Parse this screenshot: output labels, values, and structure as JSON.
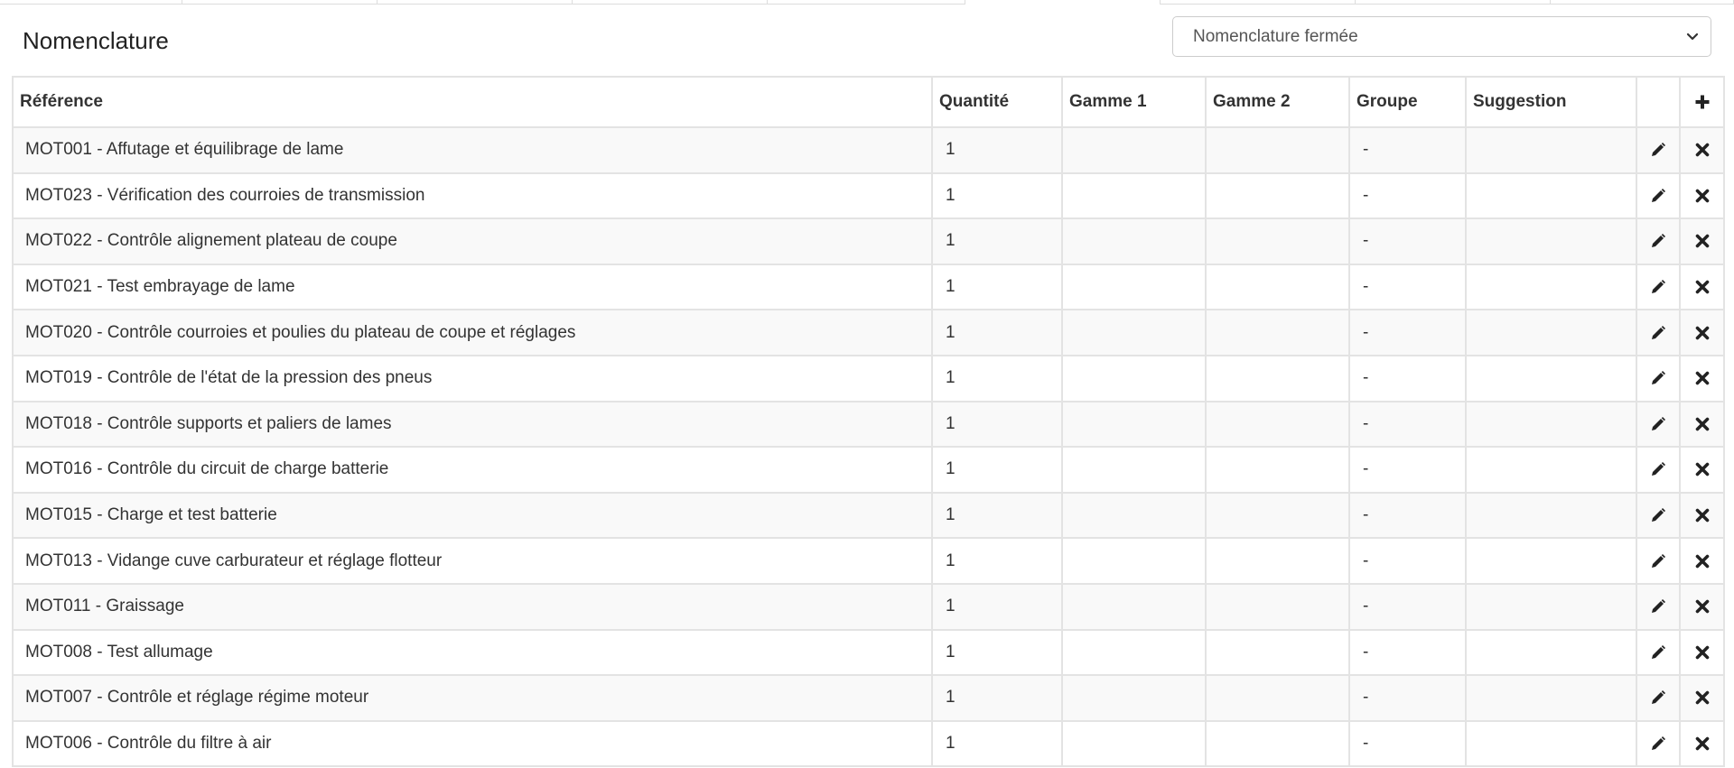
{
  "title": "Nomenclature",
  "status_select": {
    "value": "Nomenclature fermée"
  },
  "columns": {
    "reference": "Référence",
    "quantity": "Quantité",
    "gamme1": "Gamme 1",
    "gamme2": "Gamme 2",
    "groupe": "Groupe",
    "suggestion": "Suggestion"
  },
  "icons": {
    "add": "plus-icon",
    "edit": "pencil-icon",
    "delete": "times-icon",
    "select": "chevron-down-icon"
  },
  "rows": [
    {
      "reference": "MOT001 - Affutage et équilibrage de lame",
      "quantity": "1",
      "gamme1": "",
      "gamme2": "",
      "groupe": "-",
      "suggestion": ""
    },
    {
      "reference": "MOT023 - Vérification des courroies de transmission",
      "quantity": "1",
      "gamme1": "",
      "gamme2": "",
      "groupe": "-",
      "suggestion": ""
    },
    {
      "reference": "MOT022 - Contrôle alignement plateau de coupe",
      "quantity": "1",
      "gamme1": "",
      "gamme2": "",
      "groupe": "-",
      "suggestion": ""
    },
    {
      "reference": "MOT021 - Test embrayage de lame",
      "quantity": "1",
      "gamme1": "",
      "gamme2": "",
      "groupe": "-",
      "suggestion": ""
    },
    {
      "reference": "MOT020 - Contrôle courroies et poulies du plateau de coupe et réglages",
      "quantity": "1",
      "gamme1": "",
      "gamme2": "",
      "groupe": "-",
      "suggestion": ""
    },
    {
      "reference": "MOT019 - Contrôle de l'état de la pression des pneus",
      "quantity": "1",
      "gamme1": "",
      "gamme2": "",
      "groupe": "-",
      "suggestion": ""
    },
    {
      "reference": "MOT018 - Contrôle supports et paliers de lames",
      "quantity": "1",
      "gamme1": "",
      "gamme2": "",
      "groupe": "-",
      "suggestion": ""
    },
    {
      "reference": "MOT016 - Contrôle du circuit de charge batterie",
      "quantity": "1",
      "gamme1": "",
      "gamme2": "",
      "groupe": "-",
      "suggestion": ""
    },
    {
      "reference": "MOT015 - Charge et test batterie",
      "quantity": "1",
      "gamme1": "",
      "gamme2": "",
      "groupe": "-",
      "suggestion": ""
    },
    {
      "reference": "MOT013 - Vidange cuve carburateur et réglage flotteur",
      "quantity": "1",
      "gamme1": "",
      "gamme2": "",
      "groupe": "-",
      "suggestion": ""
    },
    {
      "reference": "MOT011 - Graissage",
      "quantity": "1",
      "gamme1": "",
      "gamme2": "",
      "groupe": "-",
      "suggestion": ""
    },
    {
      "reference": "MOT008 - Test allumage",
      "quantity": "1",
      "gamme1": "",
      "gamme2": "",
      "groupe": "-",
      "suggestion": ""
    },
    {
      "reference": "MOT007 - Contrôle et réglage régime moteur",
      "quantity": "1",
      "gamme1": "",
      "gamme2": "",
      "groupe": "-",
      "suggestion": ""
    },
    {
      "reference": "MOT006 - Contrôle du filtre à air",
      "quantity": "1",
      "gamme1": "",
      "gamme2": "",
      "groupe": "-",
      "suggestion": ""
    }
  ]
}
